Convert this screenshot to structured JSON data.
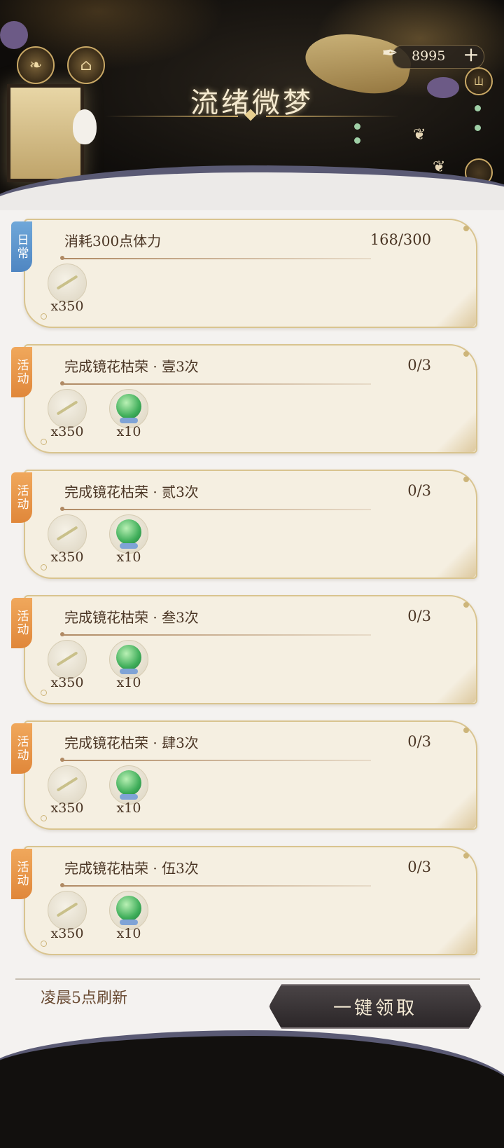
{
  "header": {
    "title": "流绪微梦",
    "currency_value": "8995",
    "currency_plus": "+",
    "top_icons": [
      "leaf-icon",
      "pavilion-icon"
    ],
    "side_icons": [
      "山",
      ""
    ]
  },
  "tasks": [
    {
      "tag": "日常",
      "tag_type": "daily",
      "title": "消耗300点体力",
      "progress": "168/300",
      "rewards": [
        {
          "icon": "feather-icon",
          "count": "x350"
        }
      ]
    },
    {
      "tag": "活动",
      "tag_type": "event",
      "title": "完成镜花枯荣 · 壹3次",
      "progress": "0/3",
      "rewards": [
        {
          "icon": "feather-icon",
          "count": "x350"
        },
        {
          "icon": "jade-orb-icon",
          "count": "x10"
        }
      ]
    },
    {
      "tag": "活动",
      "tag_type": "event",
      "title": "完成镜花枯荣 · 贰3次",
      "progress": "0/3",
      "rewards": [
        {
          "icon": "feather-icon",
          "count": "x350"
        },
        {
          "icon": "jade-orb-icon",
          "count": "x10"
        }
      ]
    },
    {
      "tag": "活动",
      "tag_type": "event",
      "title": "完成镜花枯荣 · 叁3次",
      "progress": "0/3",
      "rewards": [
        {
          "icon": "feather-icon",
          "count": "x350"
        },
        {
          "icon": "jade-orb-icon",
          "count": "x10"
        }
      ]
    },
    {
      "tag": "活动",
      "tag_type": "event",
      "title": "完成镜花枯荣 · 肆3次",
      "progress": "0/3",
      "rewards": [
        {
          "icon": "feather-icon",
          "count": "x350"
        },
        {
          "icon": "jade-orb-icon",
          "count": "x10"
        }
      ]
    },
    {
      "tag": "活动",
      "tag_type": "event",
      "title": "完成镜花枯荣 · 伍3次",
      "progress": "0/3",
      "rewards": [
        {
          "icon": "feather-icon",
          "count": "x350"
        },
        {
          "icon": "jade-orb-icon",
          "count": "x10"
        }
      ]
    }
  ],
  "footer": {
    "refresh_note": "凌晨5点刷新",
    "claim_all_label": "一键领取"
  },
  "colors": {
    "daily_tag": "#4f86c2",
    "event_tag": "#e0873a",
    "card_bg": "#f5efe1",
    "card_border": "#d9c48f",
    "text_brown": "#4a3524"
  }
}
